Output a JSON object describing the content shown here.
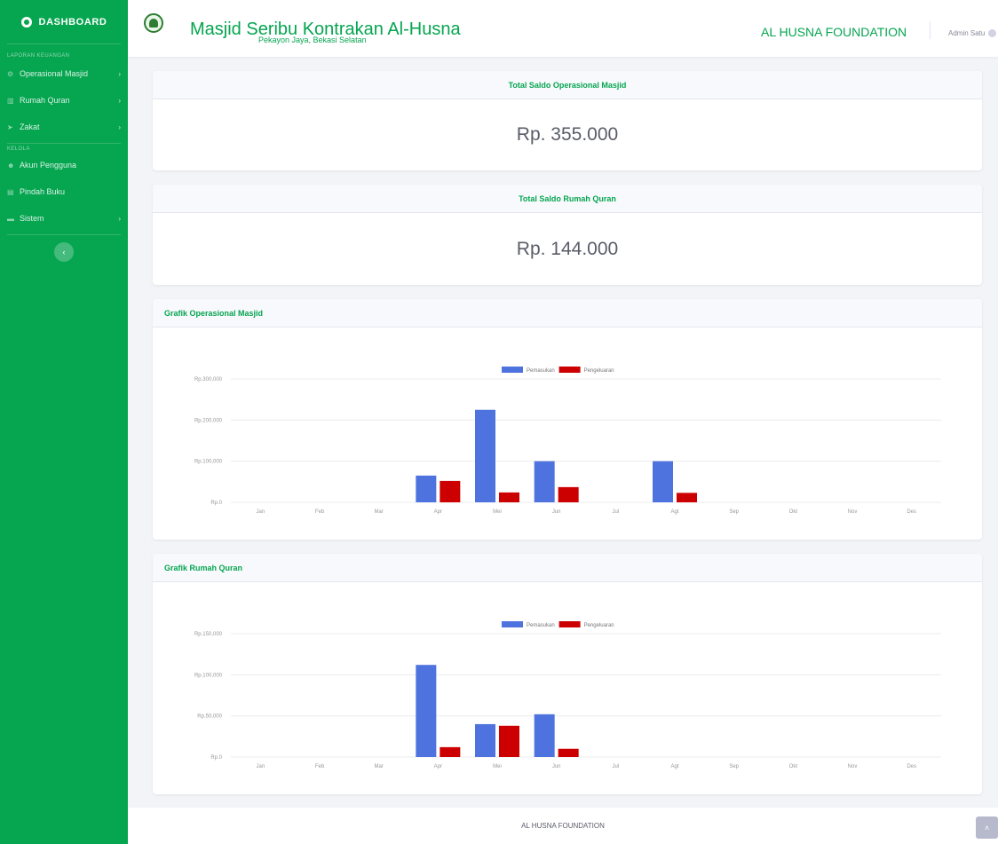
{
  "sidebar": {
    "brand": "DASHBOARD",
    "heading_keuangan": "LAPORAN KEUANGAN",
    "heading_kelola": "KELOLA",
    "items": [
      {
        "label": "Operasional Masjid",
        "icon": "gear-icon",
        "has_chevron": true
      },
      {
        "label": "Rumah Quran",
        "icon": "people-icon",
        "has_chevron": true
      },
      {
        "label": "Zakat",
        "icon": "send-icon",
        "has_chevron": true
      },
      {
        "label": "Akun Pengguna",
        "icon": "users-icon",
        "has_chevron": false
      },
      {
        "label": "Pindah Buku",
        "icon": "book-icon",
        "has_chevron": false
      },
      {
        "label": "Sistem",
        "icon": "folder-icon",
        "has_chevron": true
      }
    ],
    "chevron": "›",
    "toggle": "‹"
  },
  "topbar": {
    "title": "Masjid Seribu Kontrakan Al-Husna",
    "subtitle": "Pekayon Jaya, Bekasi Selatan",
    "foundation": "AL HUSNA FOUNDATION",
    "user": "Admin Satu"
  },
  "cards": {
    "saldo_masjid": {
      "title": "Total Saldo Operasional Masjid",
      "amount": "Rp. 355.000"
    },
    "saldo_quran": {
      "title": "Total Saldo Rumah Quran",
      "amount": "Rp. 144.000"
    },
    "grafik_masjid": {
      "title": "Grafik Operasional Masjid"
    },
    "grafik_quran": {
      "title": "Grafik Rumah Quran"
    }
  },
  "colors": {
    "primary": "#06a550",
    "pemasukan": "#4e73df",
    "pengeluaran": "#cc0000"
  },
  "chart_data": [
    {
      "type": "bar",
      "title": "",
      "categories": [
        "Jan",
        "Feb",
        "Mar",
        "Apr",
        "Mei",
        "Jun",
        "Jul",
        "Agt",
        "Sep",
        "Okt",
        "Nov",
        "Des"
      ],
      "series": [
        {
          "name": "Pemasukan",
          "color": "#4e73df",
          "values": [
            0,
            0,
            0,
            65000,
            225000,
            100000,
            0,
            100000,
            0,
            0,
            0,
            0
          ]
        },
        {
          "name": "Pengeluaran",
          "color": "#cc0000",
          "values": [
            0,
            0,
            0,
            52000,
            24000,
            37000,
            0,
            23000,
            0,
            0,
            0,
            0
          ]
        }
      ],
      "ylim": [
        0,
        300000
      ],
      "yticks": [
        0,
        100000,
        200000,
        300000
      ],
      "ytick_labels": [
        "Rp.0",
        "Rp.100,000",
        "Rp.200,000",
        "Rp.300,000"
      ],
      "legend": "top-center",
      "grid": true
    },
    {
      "type": "bar",
      "title": "",
      "categories": [
        "Jan",
        "Feb",
        "Mar",
        "Apr",
        "Mei",
        "Jun",
        "Jul",
        "Agt",
        "Sep",
        "Okt",
        "Nov",
        "Des"
      ],
      "series": [
        {
          "name": "Pemasukan",
          "color": "#4e73df",
          "values": [
            0,
            0,
            0,
            112000,
            40000,
            52000,
            0,
            0,
            0,
            0,
            0,
            0
          ]
        },
        {
          "name": "Pengeluaran",
          "color": "#cc0000",
          "values": [
            0,
            0,
            0,
            12000,
            38000,
            10000,
            0,
            0,
            0,
            0,
            0,
            0
          ]
        }
      ],
      "ylim": [
        0,
        150000
      ],
      "yticks": [
        0,
        50000,
        100000,
        150000
      ],
      "ytick_labels": [
        "Rp.0",
        "Rp.50,000",
        "Rp.100,000",
        "Rp.150,000"
      ],
      "legend": "top-center",
      "grid": true
    }
  ],
  "footer": {
    "text": "AL HUSNA FOUNDATION",
    "scroll_top": "˄"
  }
}
